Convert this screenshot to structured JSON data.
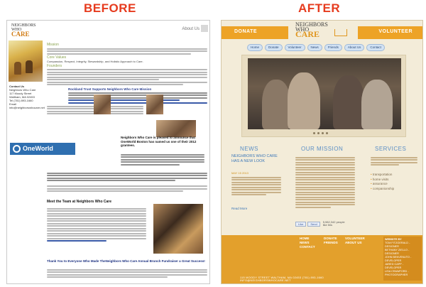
{
  "headings": {
    "before": "BEFORE",
    "after": "AFTER"
  },
  "before": {
    "logo": {
      "line1": "NEIGHBORS",
      "line2": "WHO",
      "line3": "CARE"
    },
    "about": "About Us",
    "sections": {
      "mission": "Mission",
      "values": "Core Values",
      "values_text": "Compassion, Respect, Integrity, Stewardship, and Holistic Approach to Care.",
      "founders": "Founders"
    },
    "contact": {
      "title": "Contact Us",
      "lines": [
        "Neighbors Who Care",
        "117 Moody Street",
        "Waltham, MA 02453",
        "",
        "Tel (781) 893-1660",
        "Email",
        "info@neighborswhocare.net"
      ]
    },
    "highlight_title": "Rockland Trust Supports Neighbors Who Care Mission",
    "oneworld": "OneWorld Boston",
    "oneworld_note": "Neighbors Who Care is pleased to announce that OneWorld Boston has named us one of their 2012 grantees.",
    "meet_title": "Meet the Team at Neighbors Who Care",
    "thanks_title": "Thank You to Everyone Who Made TheNeighbors Who Care Annual Brunch Fundraiser a Great Success!"
  },
  "after": {
    "topbar": {
      "donate": "DONATE",
      "volunteer": "VOLUNTEER"
    },
    "logo": {
      "line1": "NEIGHBORS",
      "line2": "WHO",
      "line3": "CARE"
    },
    "nav": [
      "Home",
      "Donate",
      "Volunteer",
      "News",
      "Friends",
      "About Us",
      "Contact"
    ],
    "news": {
      "title": "NEWS",
      "subtitle": "NEIGHBORS WHO CARE HAS A NEW LOOK",
      "date": "MAY 15 2013",
      "read_more": "Read More"
    },
    "mission": {
      "title": "OUR MISSION"
    },
    "services": {
      "title": "SERVICES",
      "items": [
        "transportation",
        "home visits",
        "assurance",
        "companionship"
      ]
    },
    "like": {
      "like": "Like",
      "send": "Send",
      "count": "5,982,342 people like this"
    },
    "footer": {
      "col1": [
        "HOME",
        "NEWS",
        "CONTACT"
      ],
      "col2": [
        "DONATE",
        "FRIENDS"
      ],
      "col3": [
        "VOLUNTEER",
        "ABOUT US"
      ],
      "site_by_title": "WEBSITE BY",
      "site_by": [
        "TOM FITZGERALD - DESIGNER",
        "BETHANY ZIELLO - DESIGNER",
        "JOHN BENVENUTO - DEVELOPER",
        "JARED CAPP - DEVELOPER",
        "LISA CRAWFORD - PHOTOGRAPHER"
      ],
      "address": "115 MOODY STREET     WALTHAM, MA 02453     (781) 893-1660",
      "email": "INFO@NEIGHBORSWHOCARE.NET"
    }
  },
  "colors": {
    "heading": "#e63b1e",
    "orange": "#eda326",
    "blue_text": "#5b8fc6",
    "green": "#8aa34f"
  }
}
